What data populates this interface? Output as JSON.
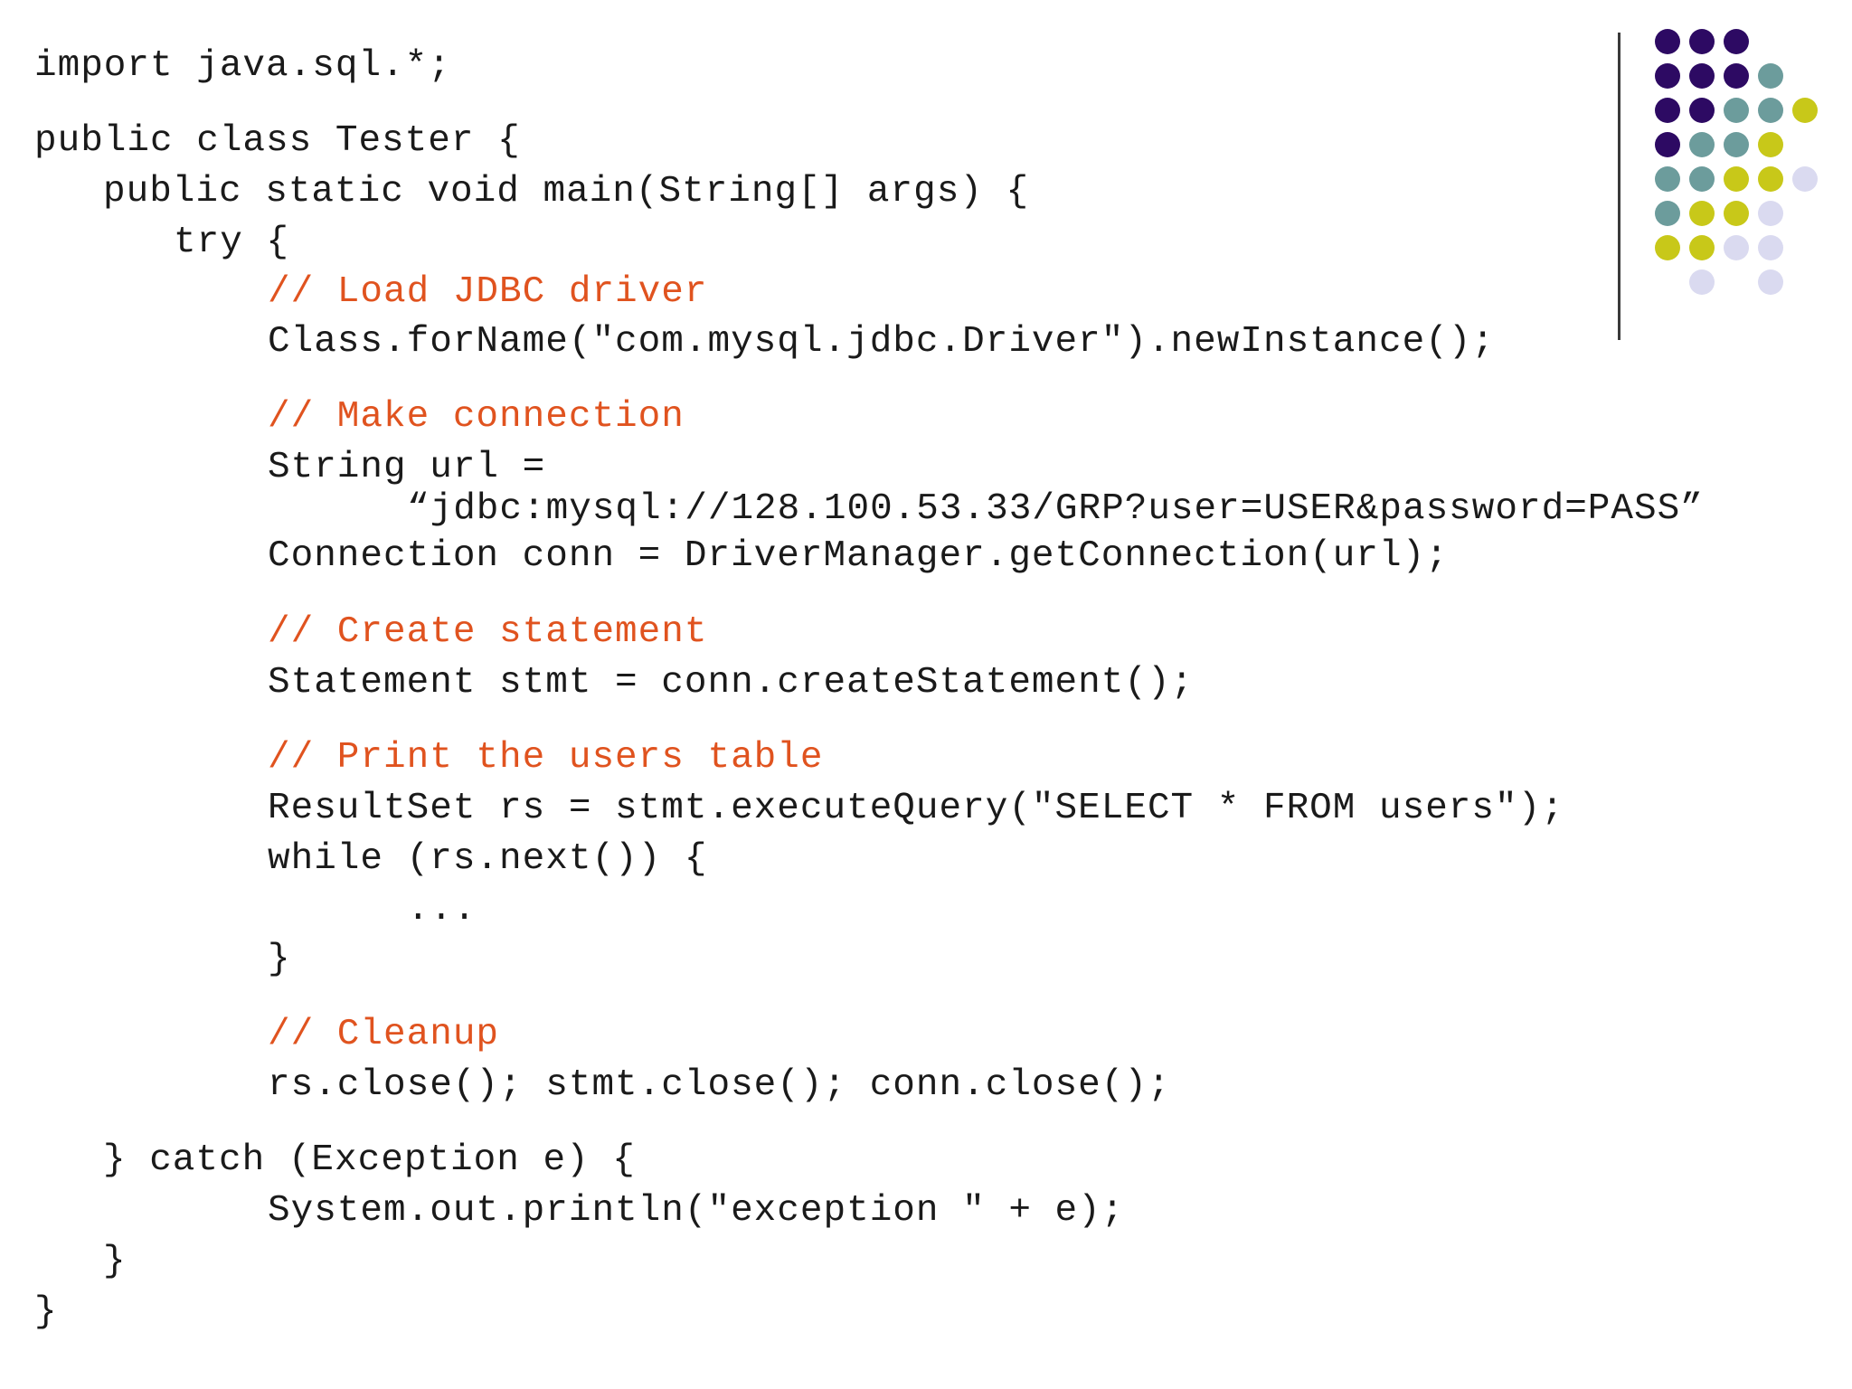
{
  "colors": {
    "code": "#1a1a1a",
    "comment": "#e0531f",
    "dot_purple": "#2d0a63",
    "dot_teal": "#6c9c9c",
    "dot_yellow": "#c8c819",
    "dot_lavender": "#dadaf0"
  },
  "code_lines": [
    "import java.sql.*;",
    "public class Tester {",
    "public static void main(String[] args) {",
    "try {",
    "// Load JDBC driver",
    "Class.forName(\"com.mysql.jdbc.Driver\").newInstance();",
    "// Make connection",
    "String url =",
    "“jdbc:mysql://128.100.53.33/GRP?user=USER&password=PASS”",
    "Connection conn = DriverManager.getConnection(url);",
    "// Create statement",
    "Statement stmt = conn.createStatement();",
    "// Print the users table",
    "ResultSet rs = stmt.executeQuery(\"SELECT * FROM users\");",
    "while (rs.next()) {",
    "...",
    "}",
    "// Cleanup",
    "rs.close(); stmt.close(); conn.close();",
    "} catch (Exception e) {",
    "System.out.println(\"exception \" + e);",
    "}",
    "}"
  ],
  "decor_dots": [
    [
      "purple",
      "purple",
      "purple",
      null,
      null
    ],
    [
      "purple",
      "purple",
      "purple",
      "teal",
      null
    ],
    [
      "purple",
      "purple",
      "teal",
      "teal",
      "yellow"
    ],
    [
      "purple",
      "teal",
      "teal",
      "yellow",
      null
    ],
    [
      "teal",
      "teal",
      "yellow",
      "yellow",
      "lavender"
    ],
    [
      "teal",
      "yellow",
      "yellow",
      "lavender",
      null
    ],
    [
      "yellow",
      "yellow",
      "lavender",
      "lavender",
      null
    ],
    [
      null,
      "lavender",
      null,
      "lavender",
      null
    ]
  ]
}
